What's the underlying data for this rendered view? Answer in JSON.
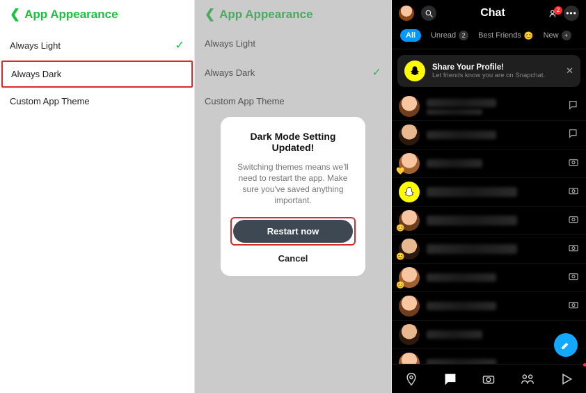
{
  "panel1": {
    "title": "App Appearance",
    "options": [
      {
        "label": "Always Light",
        "checked": true
      },
      {
        "label": "Always Dark",
        "checked": false,
        "highlighted": true
      },
      {
        "label": "Custom App Theme",
        "checked": false
      }
    ]
  },
  "panel2": {
    "title": "App Appearance",
    "options": [
      {
        "label": "Always Light",
        "checked": false
      },
      {
        "label": "Always Dark",
        "checked": true
      },
      {
        "label": "Custom App Theme",
        "checked": false
      }
    ],
    "modal": {
      "title": "Dark Mode Setting Updated!",
      "body": "Switching themes means we'll need to restart the app. Make sure you've saved anything important.",
      "restart": "Restart now",
      "cancel": "Cancel"
    }
  },
  "panel3": {
    "title": "Chat",
    "friend_badge": "2",
    "tabs": {
      "all": "All",
      "unread": "Unread",
      "unread_count": "2",
      "best": "Best Friends",
      "new": "New"
    },
    "share": {
      "title": "Share Your Profile!",
      "subtitle": "Let friends know you are on Snapchat."
    }
  }
}
